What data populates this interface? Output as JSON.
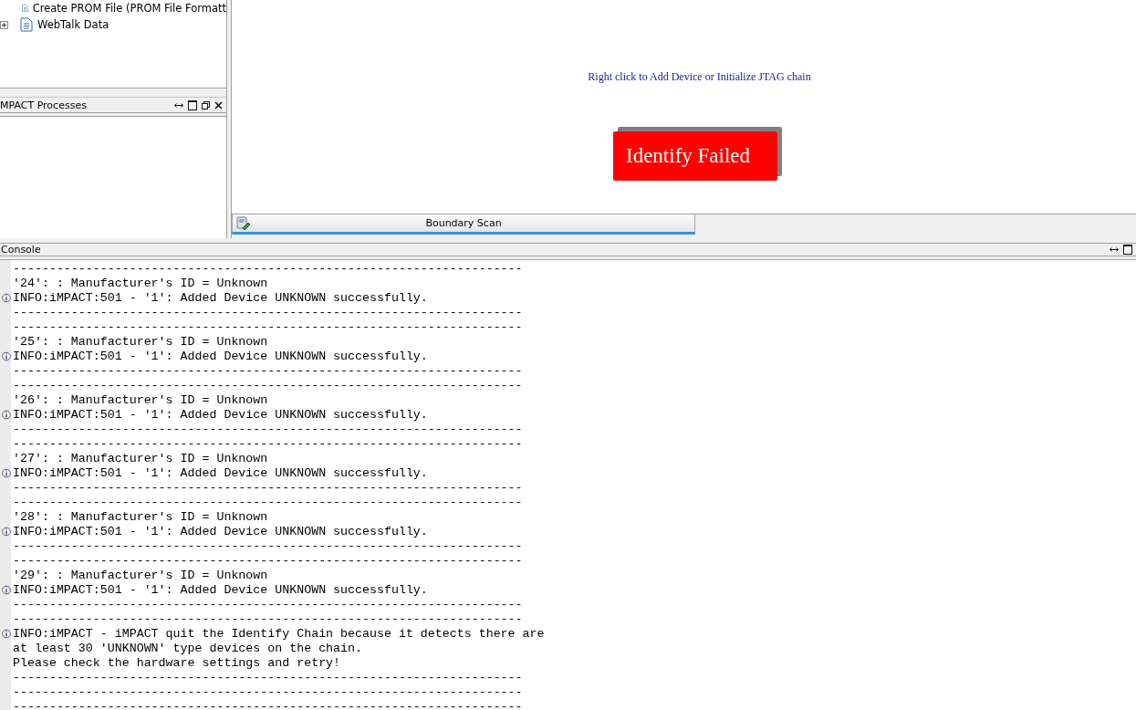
{
  "tree": {
    "items": [
      {
        "label": "Create PROM File (PROM File Formatt",
        "expandable": false
      },
      {
        "label": "WebTalk Data",
        "expandable": true
      }
    ]
  },
  "processes_panel": {
    "title": "MPACT Processes"
  },
  "canvas": {
    "hint": "Right click to Add Device or Initialize JTAG chain",
    "status": "Identify Failed"
  },
  "tabs": [
    {
      "label": "Boundary Scan",
      "selected": true
    }
  ],
  "console": {
    "title": "Console",
    "lines": [
      {
        "kind": "text",
        "text": "----------------------------------------------------------------------"
      },
      {
        "kind": "text",
        "text": "'24': : Manufacturer's ID = Unknown"
      },
      {
        "kind": "info",
        "text": "INFO:iMPACT:501 - '1': Added Device UNKNOWN successfully."
      },
      {
        "kind": "text",
        "text": "----------------------------------------------------------------------"
      },
      {
        "kind": "text",
        "text": "----------------------------------------------------------------------"
      },
      {
        "kind": "text",
        "text": "'25': : Manufacturer's ID = Unknown"
      },
      {
        "kind": "info",
        "text": "INFO:iMPACT:501 - '1': Added Device UNKNOWN successfully."
      },
      {
        "kind": "text",
        "text": "----------------------------------------------------------------------"
      },
      {
        "kind": "text",
        "text": "----------------------------------------------------------------------"
      },
      {
        "kind": "text",
        "text": "'26': : Manufacturer's ID = Unknown"
      },
      {
        "kind": "info",
        "text": "INFO:iMPACT:501 - '1': Added Device UNKNOWN successfully."
      },
      {
        "kind": "text",
        "text": "----------------------------------------------------------------------"
      },
      {
        "kind": "text",
        "text": "----------------------------------------------------------------------"
      },
      {
        "kind": "text",
        "text": "'27': : Manufacturer's ID = Unknown"
      },
      {
        "kind": "info",
        "text": "INFO:iMPACT:501 - '1': Added Device UNKNOWN successfully."
      },
      {
        "kind": "text",
        "text": "----------------------------------------------------------------------"
      },
      {
        "kind": "text",
        "text": "----------------------------------------------------------------------"
      },
      {
        "kind": "text",
        "text": "'28': : Manufacturer's ID = Unknown"
      },
      {
        "kind": "info",
        "text": "INFO:iMPACT:501 - '1': Added Device UNKNOWN successfully."
      },
      {
        "kind": "text",
        "text": "----------------------------------------------------------------------"
      },
      {
        "kind": "text",
        "text": "----------------------------------------------------------------------"
      },
      {
        "kind": "text",
        "text": "'29': : Manufacturer's ID = Unknown"
      },
      {
        "kind": "info",
        "text": "INFO:iMPACT:501 - '1': Added Device UNKNOWN successfully."
      },
      {
        "kind": "text",
        "text": "----------------------------------------------------------------------"
      },
      {
        "kind": "text",
        "text": "----------------------------------------------------------------------"
      },
      {
        "kind": "info",
        "text": "INFO:iMPACT - iMPACT quit the Identify Chain because it detects there are"
      },
      {
        "kind": "text",
        "text": "at least 30 'UNKNOWN' type devices on the chain."
      },
      {
        "kind": "text",
        "text": "Please check the hardware settings and retry!"
      },
      {
        "kind": "text",
        "text": "----------------------------------------------------------------------"
      },
      {
        "kind": "text",
        "text": "----------------------------------------------------------------------"
      },
      {
        "kind": "text",
        "text": "----------------------------------------------------------------------"
      }
    ]
  }
}
